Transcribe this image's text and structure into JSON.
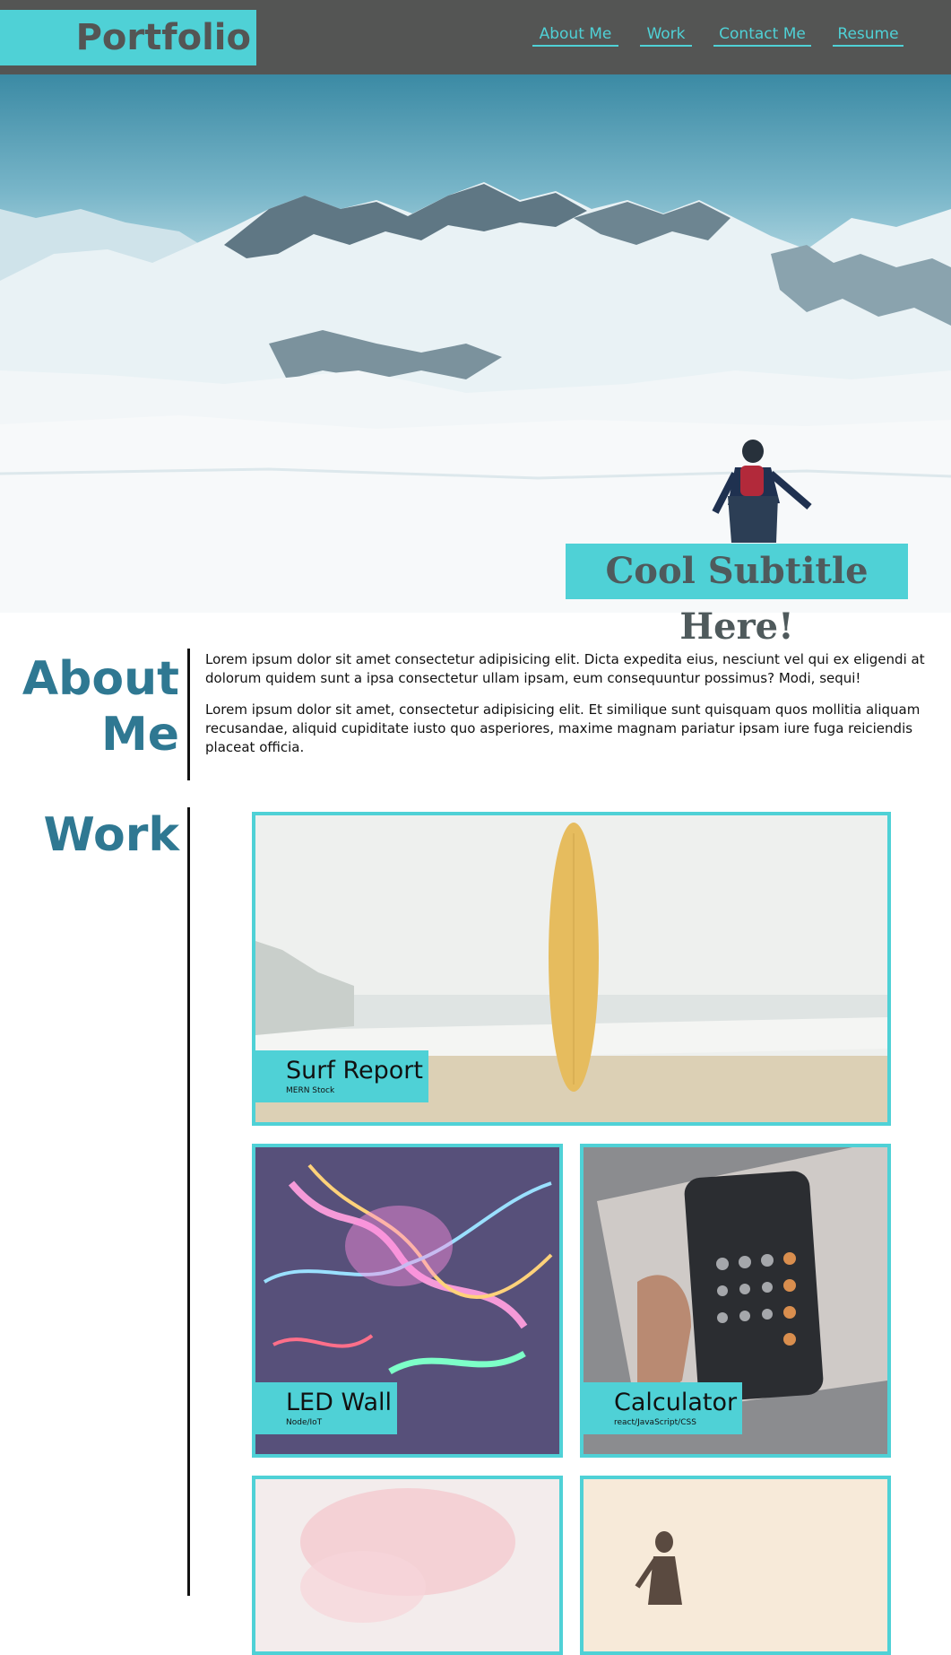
{
  "header": {
    "logo": "Portfolio",
    "nav": [
      "About Me",
      "Work",
      "Contact Me",
      "Resume"
    ]
  },
  "hero": {
    "subtitle": "Cool Subtitle Here!"
  },
  "about": {
    "title_line1": "About",
    "title_line2": "Me",
    "p1": "Lorem ipsum dolor sit amet consectetur adipisicing elit. Dicta expedita eius, nesciunt vel qui ex eligendi at dolorum quidem sunt a ipsa consectetur ullam ipsam, eum consequuntur possimus? Modi, sequi!",
    "p2": "Lorem ipsum dolor sit amet, consectetur adipisicing elit. Et similique sunt quisquam quos mollitia aliquam recusandae, aliquid cupiditate iusto quo asperiores, maxime magnam pariatur ipsam iure fuga reiciendis placeat officia."
  },
  "work": {
    "title": "Work",
    "projects": [
      {
        "title": "Surf Report",
        "tech": "MERN Stock"
      },
      {
        "title": "LED Wall",
        "tech": "Node/IoT"
      },
      {
        "title": "Calculator",
        "tech": "react/JavaScript/CSS"
      }
    ]
  },
  "colors": {
    "accent": "#4fd1d6",
    "header_bg": "#545554",
    "heading": "#2f7892"
  }
}
